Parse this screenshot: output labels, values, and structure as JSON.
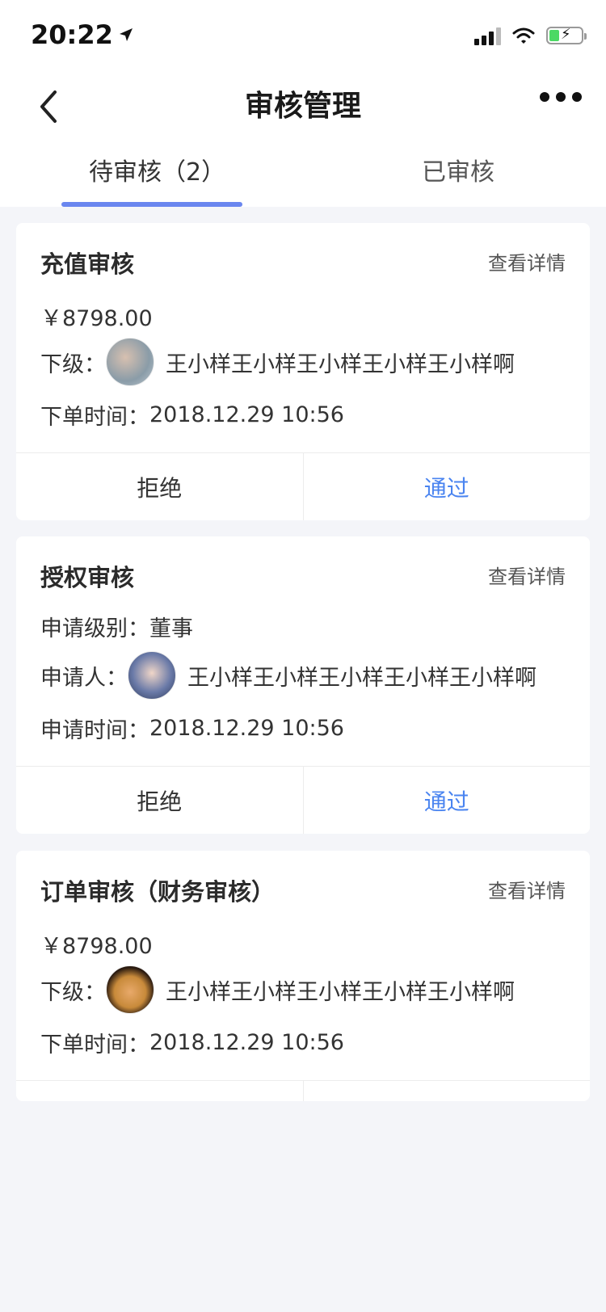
{
  "status_bar": {
    "time": "20:22"
  },
  "header": {
    "title": "审核管理"
  },
  "tabs": [
    {
      "label": "待审核（2）",
      "active": true
    },
    {
      "label": "已审核",
      "active": false
    }
  ],
  "accent": "#6a86ef",
  "approve_color": "#4a84f0",
  "cards": [
    {
      "title": "充值审核",
      "detail_link": "查看详情",
      "amount": "￥8798.00",
      "person_label": "下级：",
      "person_name": "王小样王小样王小样王小样王小样啊",
      "time_label": "下单时间：",
      "time_value": "2018.12.29 10:56",
      "reject": "拒绝",
      "approve": "通过"
    },
    {
      "title": "授权审核",
      "detail_link": "查看详情",
      "level_label": "申请级别：",
      "level_value": "董事",
      "person_label": "申请人：",
      "person_name": "王小样王小样王小样王小样王小样啊",
      "time_label": "申请时间：",
      "time_value": "2018.12.29 10:56",
      "reject": "拒绝",
      "approve": "通过"
    },
    {
      "title": "订单审核（财务审核）",
      "detail_link": "查看详情",
      "amount": "￥8798.00",
      "person_label": "下级：",
      "person_name": "王小样王小样王小样王小样王小样啊",
      "time_label": "下单时间：",
      "time_value": "2018.12.29 10:56"
    }
  ]
}
